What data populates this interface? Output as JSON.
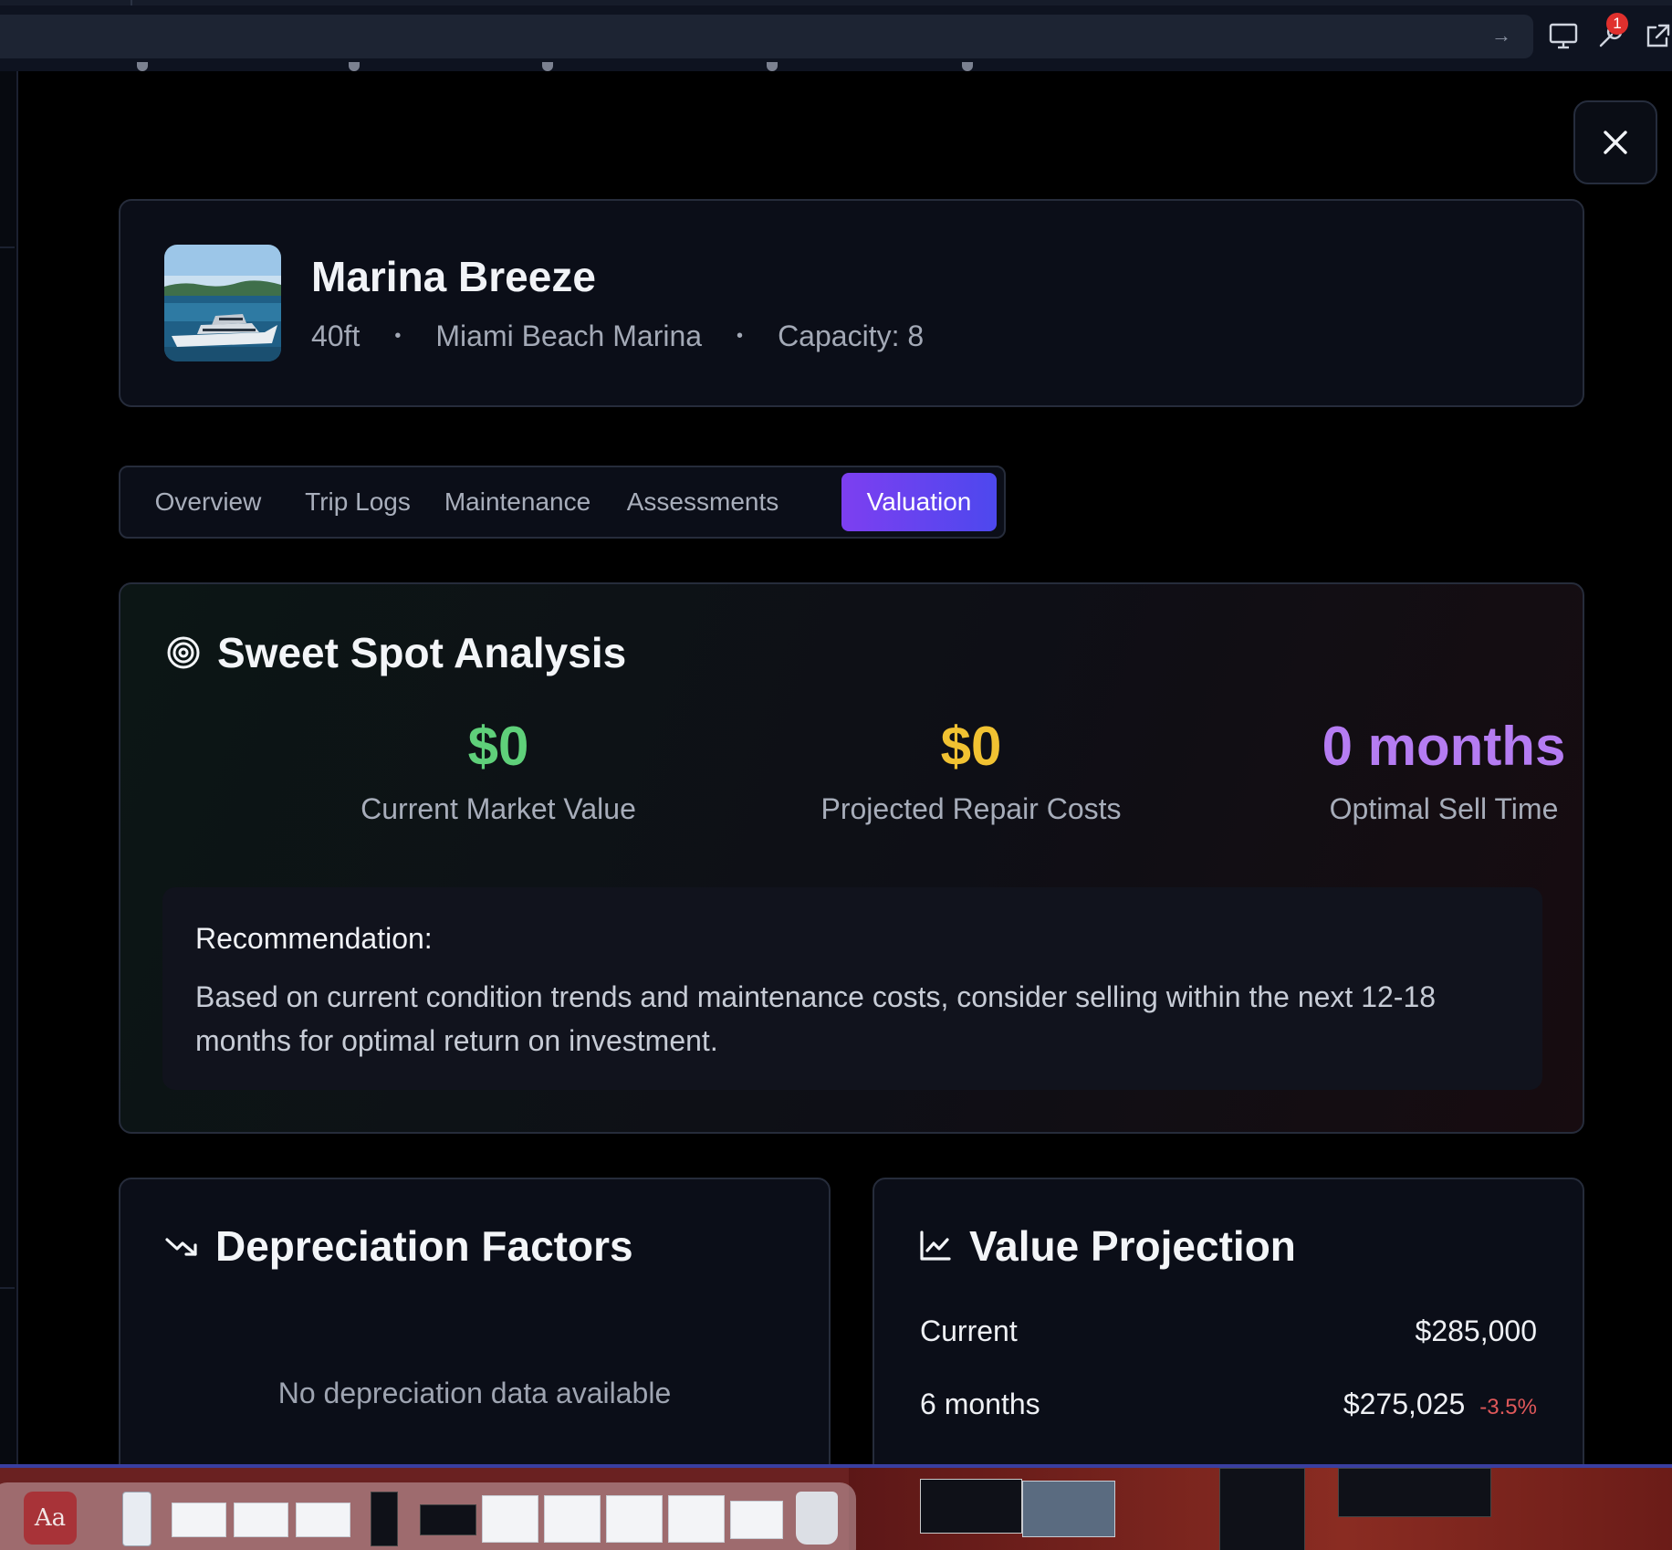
{
  "boat": {
    "name": "Marina Breeze",
    "length": "40ft",
    "marina": "Miami Beach Marina",
    "capacity": "Capacity: 8",
    "separator": "•"
  },
  "tabs": [
    {
      "label": "Overview",
      "active": false
    },
    {
      "label": "Trip Logs",
      "active": false
    },
    {
      "label": "Maintenance",
      "active": false
    },
    {
      "label": "Assessments",
      "active": false
    },
    {
      "label": "Valuation",
      "active": true
    }
  ],
  "sweet_spot": {
    "title": "Sweet Spot Analysis",
    "metrics": [
      {
        "value": "$0",
        "label": "Current Market Value",
        "color": "#5fd07a"
      },
      {
        "value": "$0",
        "label": "Projected Repair Costs",
        "color": "#f1c232"
      },
      {
        "value": "0 months",
        "label": "Optimal Sell Time",
        "color": "#b57cf2"
      }
    ],
    "recommendation_title": "Recommendation:",
    "recommendation_text": "Based on current condition trends and maintenance costs, consider selling within the next 12-18 months for optimal return on investment."
  },
  "depreciation": {
    "title": "Depreciation Factors",
    "empty_message": "No depreciation data available"
  },
  "projection": {
    "title": "Value Projection",
    "rows": [
      {
        "period": "Current",
        "value": "$285,000",
        "change": ""
      },
      {
        "period": "6 months",
        "value": "$275,025",
        "change": "-3.5%"
      }
    ]
  },
  "toolbar": {
    "notification_count": "1"
  },
  "dock": {
    "dictionary_label": "Aa"
  },
  "colors": {
    "accent_from": "#7d3ff0",
    "accent_to": "#4d48ee",
    "negative": "#e0585a"
  },
  "icons": [
    "close-icon",
    "target-icon",
    "trending-down-icon",
    "line-chart-icon",
    "monitor-icon",
    "wrench-icon",
    "external-link-icon",
    "arrow-right-icon"
  ]
}
